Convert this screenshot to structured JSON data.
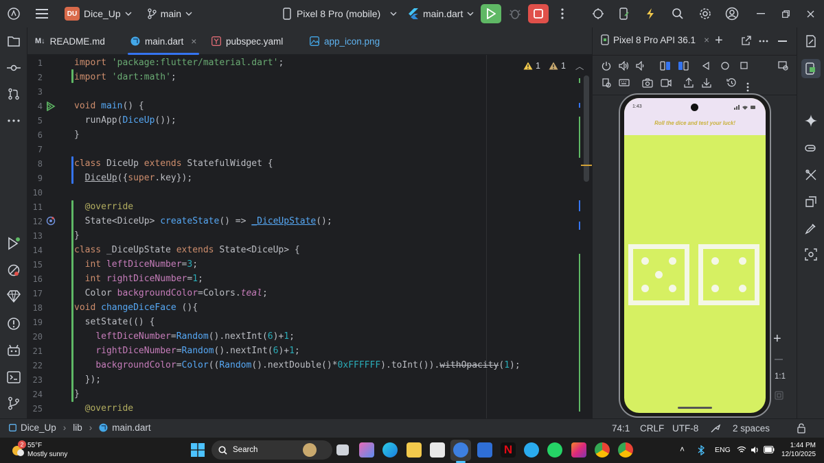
{
  "titlebar": {
    "project_badge": "DU",
    "project_name": "Dice_Up",
    "branch": "main",
    "device": "Pixel 8 Pro (mobile)",
    "run_config": "main.dart"
  },
  "tabs": [
    {
      "label": "README.md",
      "badge": "M↓",
      "active": false
    },
    {
      "label": "main.dart",
      "active": true
    },
    {
      "label": "pubspec.yaml",
      "active": false
    },
    {
      "label": "app_icon.png",
      "active": false
    }
  ],
  "editor": {
    "inspection": {
      "warnings": "1",
      "weak_warnings": "1"
    },
    "line_numbers": [
      "1",
      "2",
      "3",
      "4",
      "5",
      "6",
      "7",
      "8",
      "9",
      "10",
      "11",
      "12",
      "13",
      "14",
      "15",
      "16",
      "17",
      "18",
      "19",
      "20",
      "21",
      "22",
      "23",
      "24",
      "25"
    ]
  },
  "emulator": {
    "tab_title": "Pixel 8 Pro API 36.1",
    "phone_time": "1:43",
    "app_bar_text": "Roll the dice and test your luck!",
    "zoom_label": "1:1",
    "left_dice_value": 5,
    "right_dice_value": 4,
    "colors": {
      "screen": "#d6f062",
      "app_bar": "#ede3f3",
      "dice": "#f4f7e6"
    }
  },
  "statusbar": {
    "breadcrumb": [
      "Dice_Up",
      "lib",
      "main.dart"
    ],
    "position": "74:1",
    "line_ending": "CRLF",
    "encoding": "UTF-8",
    "indent": "2 spaces"
  },
  "taskbar": {
    "weather_temp": "55°F",
    "weather_desc": "Mostly sunny",
    "weather_badge": "2",
    "search_placeholder": "Search",
    "language": "ENG",
    "time": "1:44 PM",
    "date": "12/10/2025"
  }
}
